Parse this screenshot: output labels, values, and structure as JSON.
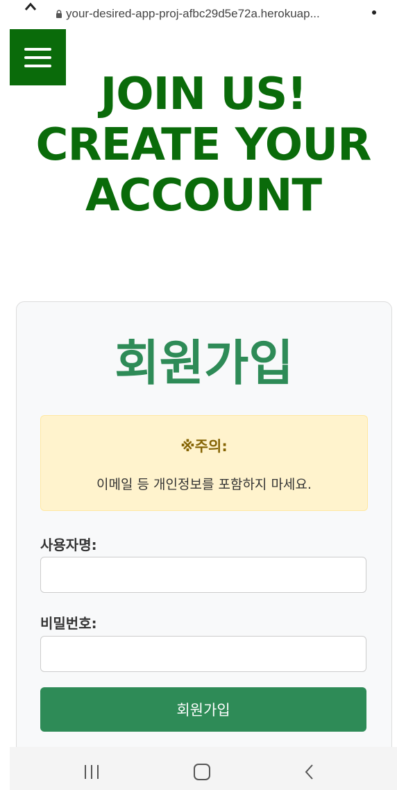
{
  "browser": {
    "url": "your-desired-app-proj-afbc29d5e72a.herokuap..."
  },
  "header": {
    "menu_icon": "hamburger-menu-icon",
    "title_lines": [
      "JOIN US!",
      "CREATE YOUR",
      "ACCOUNT"
    ]
  },
  "card": {
    "title": "회원가입",
    "notice": {
      "title": "※주의:",
      "text": "이메일 등 개인정보를 포함하지 마세요."
    },
    "username": {
      "label": "사용자명:",
      "value": ""
    },
    "password": {
      "label": "비밀번호:",
      "value": ""
    },
    "submit_label": "회원가입"
  },
  "system_nav": {
    "icons": [
      "recents-icon",
      "home-icon",
      "back-icon"
    ]
  },
  "colors": {
    "brand_green": "#0a6b0a",
    "accent_green": "#2e8b57",
    "notice_bg": "#fff3cd",
    "notice_title": "#856404"
  }
}
